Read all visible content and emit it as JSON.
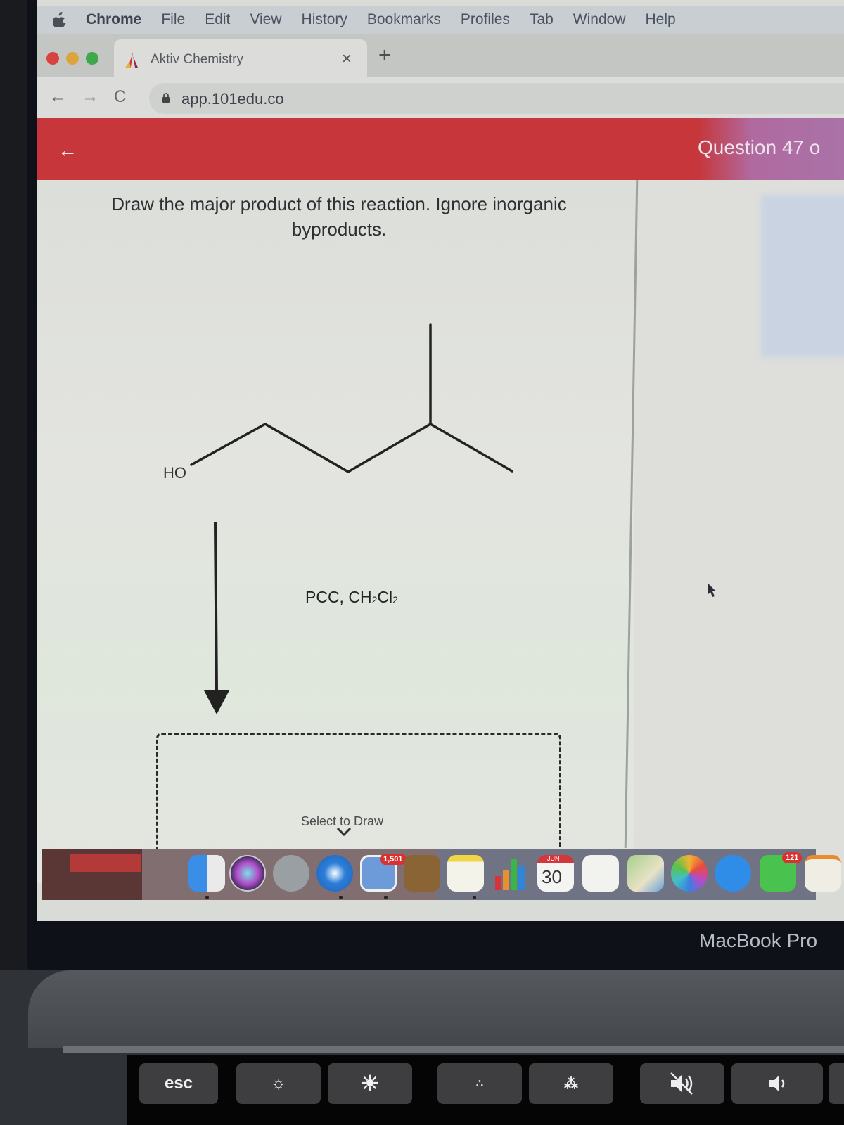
{
  "menubar": {
    "items": [
      "Chrome",
      "File",
      "Edit",
      "View",
      "History",
      "Bookmarks",
      "Profiles",
      "Tab",
      "Window",
      "Help"
    ]
  },
  "browser": {
    "tab_title": "Aktiv Chemistry",
    "url": "app.101edu.co",
    "new_tab_label": "+",
    "close_tab_label": "×"
  },
  "app": {
    "question_label": "Question 47 o",
    "prompt": "Draw the major product of this reaction. Ignore inorganic byproducts.",
    "reactant": {
      "name": "4-methylpentan-1-ol (skeletal)",
      "hydroxyl_label": "HO"
    },
    "reagent": {
      "text_main": "PCC, CH",
      "sub1": "2",
      "text_mid": "Cl",
      "sub2": "2"
    },
    "draw_area_label": "Select to Draw"
  },
  "dock": {
    "mail_badge": "1,501",
    "calendar_month": "JUN",
    "calendar_day": "30",
    "facetime_badge": "121",
    "apps": [
      "Finder",
      "Siri",
      "Launchpad",
      "Safari",
      "Mail",
      "Contacts",
      "Notes",
      "Numbers",
      "Calendar",
      "Reminders",
      "Maps",
      "Photos",
      "Messages",
      "FaceTime",
      "Pages"
    ]
  },
  "hardware": {
    "model_label": "MacBook Pro",
    "touchbar": {
      "esc_label": "esc",
      "keys": [
        "brightness-down",
        "brightness-up",
        "keyboard-light-down",
        "keyboard-light-up",
        "mute",
        "volume-down"
      ]
    }
  }
}
